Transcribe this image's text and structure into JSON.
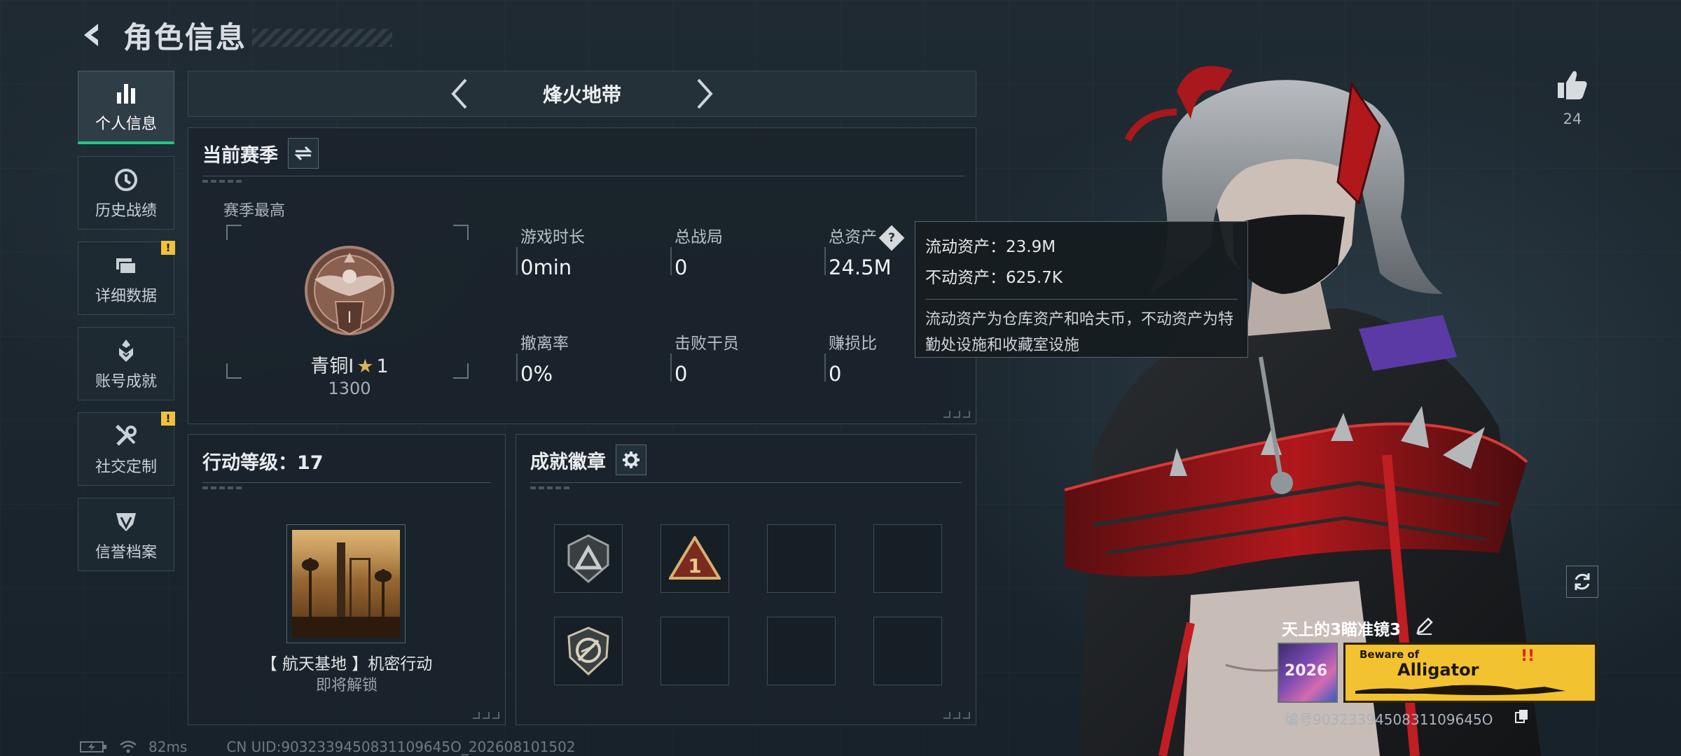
{
  "header": {
    "title": "角色信息"
  },
  "nav": {
    "items": [
      {
        "label": "个人信息",
        "icon": "bar-chart-icon",
        "active": true
      },
      {
        "label": "历史战绩",
        "icon": "clock-icon"
      },
      {
        "label": "详细数据",
        "icon": "folder-icon",
        "alert": "!"
      },
      {
        "label": "账号成就",
        "icon": "achievement-icon"
      },
      {
        "label": "社交定制",
        "icon": "tools-icon",
        "alert": "!"
      },
      {
        "label": "信誉档案",
        "icon": "shield-icon"
      }
    ]
  },
  "mode": {
    "label": "烽火地带"
  },
  "season": {
    "title": "当前赛季",
    "peak_label": "赛季最高",
    "rank": {
      "name": "青铜I",
      "stars": "1",
      "score": "1300"
    },
    "stats": [
      {
        "label": "游戏时长",
        "value": "0min"
      },
      {
        "label": "总战局",
        "value": "0"
      },
      {
        "label": "总资产",
        "value": "24.5M"
      },
      {
        "label": "撤离率",
        "value": "0%"
      },
      {
        "label": "击败干员",
        "value": "0"
      },
      {
        "label": "赚损比",
        "value": "0"
      }
    ]
  },
  "tooltip": {
    "liquid_label": "流动资产：",
    "liquid_value": "23.9M",
    "fixed_label": "不动资产：",
    "fixed_value": "625.7K",
    "desc": "流动资产为仓库资产和哈夫币，不动资产为特勤处设施和收藏室设施"
  },
  "level": {
    "title": "行动等级：17",
    "mission_name": "【 航天基地 】机密行动",
    "mission_status": "即将解锁"
  },
  "badges": {
    "title": "成就徽章"
  },
  "likes": {
    "count": "24"
  },
  "player": {
    "name": "天上的3瞄准镜3",
    "avatar_text": "2026",
    "nameplate_top": "Beware of",
    "nameplate_main": "Alligator",
    "id": "编号9032339450831109645O"
  },
  "status": {
    "ping": "82ms",
    "uid": "CN UID:9032339450831109645O_202608101502"
  },
  "colors": {
    "accent": "#22c77f",
    "alert": "#f0c23c",
    "nameplate": "#f2c230"
  }
}
